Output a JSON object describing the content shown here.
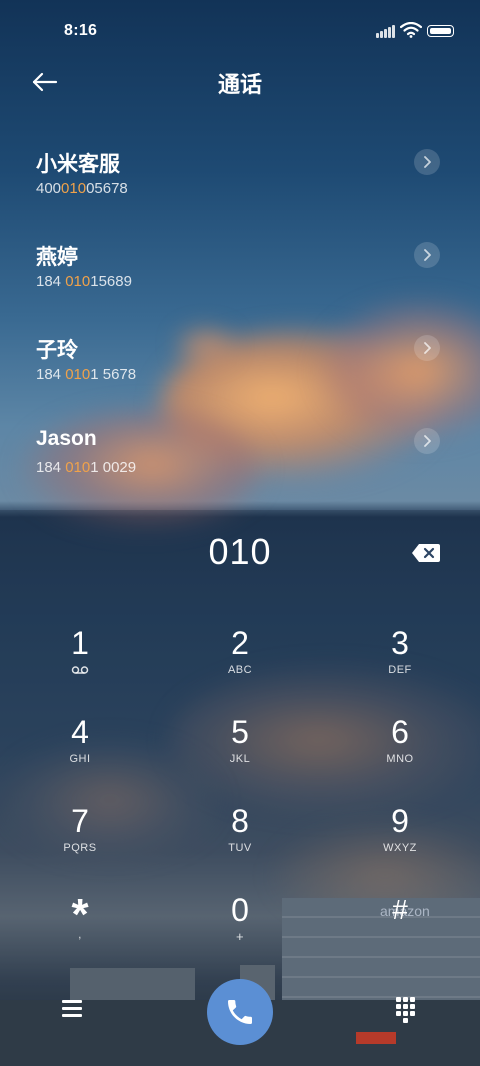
{
  "status_bar": {
    "time": "8:16"
  },
  "header": {
    "title": "通话"
  },
  "contacts": [
    {
      "name": "小米客服",
      "number_pre": "400",
      "number_match": "010",
      "number_post": "05678"
    },
    {
      "name": "燕婷",
      "number_pre": "184 ",
      "number_match": "010",
      "number_post": "15689"
    },
    {
      "name": "子玲",
      "number_pre": "184 ",
      "number_match": "010",
      "number_post": "1 5678"
    },
    {
      "name": "Jason",
      "number_pre": "184 ",
      "number_match": "010",
      "number_post": "1 0029"
    }
  ],
  "dialer": {
    "input_value": "010"
  },
  "keypad": [
    {
      "digit": "1",
      "letters": ""
    },
    {
      "digit": "2",
      "letters": "ABC"
    },
    {
      "digit": "3",
      "letters": "DEF"
    },
    {
      "digit": "4",
      "letters": "GHI"
    },
    {
      "digit": "5",
      "letters": "JKL"
    },
    {
      "digit": "6",
      "letters": "MNO"
    },
    {
      "digit": "7",
      "letters": "PQRS"
    },
    {
      "digit": "8",
      "letters": "TUV"
    },
    {
      "digit": "9",
      "letters": "WXYZ"
    },
    {
      "digit": "*",
      "letters": ","
    },
    {
      "digit": "0",
      "letters": "+"
    },
    {
      "digit": "#",
      "letters": ""
    }
  ],
  "background_text": {
    "brand": "amazon"
  },
  "colors": {
    "highlight": "#f0a24a",
    "call_button": "#5b8fd4"
  },
  "icons": {
    "back": "back-arrow-icon",
    "voicemail": "voicemail-icon",
    "backspace": "backspace-icon",
    "menu": "menu-icon",
    "call": "phone-icon",
    "keypad": "keypad-icon"
  }
}
